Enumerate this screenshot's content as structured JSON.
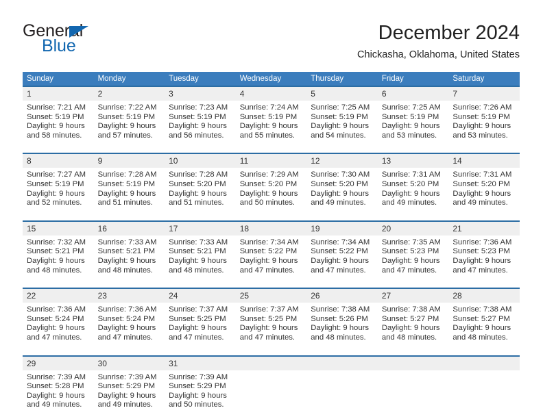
{
  "logo": {
    "word_one": "General",
    "word_two": "Blue",
    "triangle_color": "#1267b0",
    "text_color": "#231f20"
  },
  "header": {
    "title": "December 2024",
    "location": "Chickasha, Oklahoma, United States"
  },
  "theme": {
    "header_blue": "#3b7dbd",
    "rule_blue": "#2c6da4",
    "daynum_band": "#efefef",
    "text": "#333333"
  },
  "calendar": {
    "weekday_headers": [
      "Sunday",
      "Monday",
      "Tuesday",
      "Wednesday",
      "Thursday",
      "Friday",
      "Saturday"
    ],
    "weeks": [
      [
        {
          "day": "1",
          "sunrise": "Sunrise: 7:21 AM",
          "sunset": "Sunset: 5:19 PM",
          "daylight_line1": "Daylight: 9 hours",
          "daylight_line2": "and 58 minutes."
        },
        {
          "day": "2",
          "sunrise": "Sunrise: 7:22 AM",
          "sunset": "Sunset: 5:19 PM",
          "daylight_line1": "Daylight: 9 hours",
          "daylight_line2": "and 57 minutes."
        },
        {
          "day": "3",
          "sunrise": "Sunrise: 7:23 AM",
          "sunset": "Sunset: 5:19 PM",
          "daylight_line1": "Daylight: 9 hours",
          "daylight_line2": "and 56 minutes."
        },
        {
          "day": "4",
          "sunrise": "Sunrise: 7:24 AM",
          "sunset": "Sunset: 5:19 PM",
          "daylight_line1": "Daylight: 9 hours",
          "daylight_line2": "and 55 minutes."
        },
        {
          "day": "5",
          "sunrise": "Sunrise: 7:25 AM",
          "sunset": "Sunset: 5:19 PM",
          "daylight_line1": "Daylight: 9 hours",
          "daylight_line2": "and 54 minutes."
        },
        {
          "day": "6",
          "sunrise": "Sunrise: 7:25 AM",
          "sunset": "Sunset: 5:19 PM",
          "daylight_line1": "Daylight: 9 hours",
          "daylight_line2": "and 53 minutes."
        },
        {
          "day": "7",
          "sunrise": "Sunrise: 7:26 AM",
          "sunset": "Sunset: 5:19 PM",
          "daylight_line1": "Daylight: 9 hours",
          "daylight_line2": "and 53 minutes."
        }
      ],
      [
        {
          "day": "8",
          "sunrise": "Sunrise: 7:27 AM",
          "sunset": "Sunset: 5:19 PM",
          "daylight_line1": "Daylight: 9 hours",
          "daylight_line2": "and 52 minutes."
        },
        {
          "day": "9",
          "sunrise": "Sunrise: 7:28 AM",
          "sunset": "Sunset: 5:19 PM",
          "daylight_line1": "Daylight: 9 hours",
          "daylight_line2": "and 51 minutes."
        },
        {
          "day": "10",
          "sunrise": "Sunrise: 7:28 AM",
          "sunset": "Sunset: 5:20 PM",
          "daylight_line1": "Daylight: 9 hours",
          "daylight_line2": "and 51 minutes."
        },
        {
          "day": "11",
          "sunrise": "Sunrise: 7:29 AM",
          "sunset": "Sunset: 5:20 PM",
          "daylight_line1": "Daylight: 9 hours",
          "daylight_line2": "and 50 minutes."
        },
        {
          "day": "12",
          "sunrise": "Sunrise: 7:30 AM",
          "sunset": "Sunset: 5:20 PM",
          "daylight_line1": "Daylight: 9 hours",
          "daylight_line2": "and 49 minutes."
        },
        {
          "day": "13",
          "sunrise": "Sunrise: 7:31 AM",
          "sunset": "Sunset: 5:20 PM",
          "daylight_line1": "Daylight: 9 hours",
          "daylight_line2": "and 49 minutes."
        },
        {
          "day": "14",
          "sunrise": "Sunrise: 7:31 AM",
          "sunset": "Sunset: 5:20 PM",
          "daylight_line1": "Daylight: 9 hours",
          "daylight_line2": "and 49 minutes."
        }
      ],
      [
        {
          "day": "15",
          "sunrise": "Sunrise: 7:32 AM",
          "sunset": "Sunset: 5:21 PM",
          "daylight_line1": "Daylight: 9 hours",
          "daylight_line2": "and 48 minutes."
        },
        {
          "day": "16",
          "sunrise": "Sunrise: 7:33 AM",
          "sunset": "Sunset: 5:21 PM",
          "daylight_line1": "Daylight: 9 hours",
          "daylight_line2": "and 48 minutes."
        },
        {
          "day": "17",
          "sunrise": "Sunrise: 7:33 AM",
          "sunset": "Sunset: 5:21 PM",
          "daylight_line1": "Daylight: 9 hours",
          "daylight_line2": "and 48 minutes."
        },
        {
          "day": "18",
          "sunrise": "Sunrise: 7:34 AM",
          "sunset": "Sunset: 5:22 PM",
          "daylight_line1": "Daylight: 9 hours",
          "daylight_line2": "and 47 minutes."
        },
        {
          "day": "19",
          "sunrise": "Sunrise: 7:34 AM",
          "sunset": "Sunset: 5:22 PM",
          "daylight_line1": "Daylight: 9 hours",
          "daylight_line2": "and 47 minutes."
        },
        {
          "day": "20",
          "sunrise": "Sunrise: 7:35 AM",
          "sunset": "Sunset: 5:23 PM",
          "daylight_line1": "Daylight: 9 hours",
          "daylight_line2": "and 47 minutes."
        },
        {
          "day": "21",
          "sunrise": "Sunrise: 7:36 AM",
          "sunset": "Sunset: 5:23 PM",
          "daylight_line1": "Daylight: 9 hours",
          "daylight_line2": "and 47 minutes."
        }
      ],
      [
        {
          "day": "22",
          "sunrise": "Sunrise: 7:36 AM",
          "sunset": "Sunset: 5:24 PM",
          "daylight_line1": "Daylight: 9 hours",
          "daylight_line2": "and 47 minutes."
        },
        {
          "day": "23",
          "sunrise": "Sunrise: 7:36 AM",
          "sunset": "Sunset: 5:24 PM",
          "daylight_line1": "Daylight: 9 hours",
          "daylight_line2": "and 47 minutes."
        },
        {
          "day": "24",
          "sunrise": "Sunrise: 7:37 AM",
          "sunset": "Sunset: 5:25 PM",
          "daylight_line1": "Daylight: 9 hours",
          "daylight_line2": "and 47 minutes."
        },
        {
          "day": "25",
          "sunrise": "Sunrise: 7:37 AM",
          "sunset": "Sunset: 5:25 PM",
          "daylight_line1": "Daylight: 9 hours",
          "daylight_line2": "and 47 minutes."
        },
        {
          "day": "26",
          "sunrise": "Sunrise: 7:38 AM",
          "sunset": "Sunset: 5:26 PM",
          "daylight_line1": "Daylight: 9 hours",
          "daylight_line2": "and 48 minutes."
        },
        {
          "day": "27",
          "sunrise": "Sunrise: 7:38 AM",
          "sunset": "Sunset: 5:27 PM",
          "daylight_line1": "Daylight: 9 hours",
          "daylight_line2": "and 48 minutes."
        },
        {
          "day": "28",
          "sunrise": "Sunrise: 7:38 AM",
          "sunset": "Sunset: 5:27 PM",
          "daylight_line1": "Daylight: 9 hours",
          "daylight_line2": "and 48 minutes."
        }
      ],
      [
        {
          "day": "29",
          "sunrise": "Sunrise: 7:39 AM",
          "sunset": "Sunset: 5:28 PM",
          "daylight_line1": "Daylight: 9 hours",
          "daylight_line2": "and 49 minutes."
        },
        {
          "day": "30",
          "sunrise": "Sunrise: 7:39 AM",
          "sunset": "Sunset: 5:29 PM",
          "daylight_line1": "Daylight: 9 hours",
          "daylight_line2": "and 49 minutes."
        },
        {
          "day": "31",
          "sunrise": "Sunrise: 7:39 AM",
          "sunset": "Sunset: 5:29 PM",
          "daylight_line1": "Daylight: 9 hours",
          "daylight_line2": "and 50 minutes."
        },
        {
          "day": "",
          "sunrise": "",
          "sunset": "",
          "daylight_line1": "",
          "daylight_line2": ""
        },
        {
          "day": "",
          "sunrise": "",
          "sunset": "",
          "daylight_line1": "",
          "daylight_line2": ""
        },
        {
          "day": "",
          "sunrise": "",
          "sunset": "",
          "daylight_line1": "",
          "daylight_line2": ""
        },
        {
          "day": "",
          "sunrise": "",
          "sunset": "",
          "daylight_line1": "",
          "daylight_line2": ""
        }
      ]
    ]
  }
}
